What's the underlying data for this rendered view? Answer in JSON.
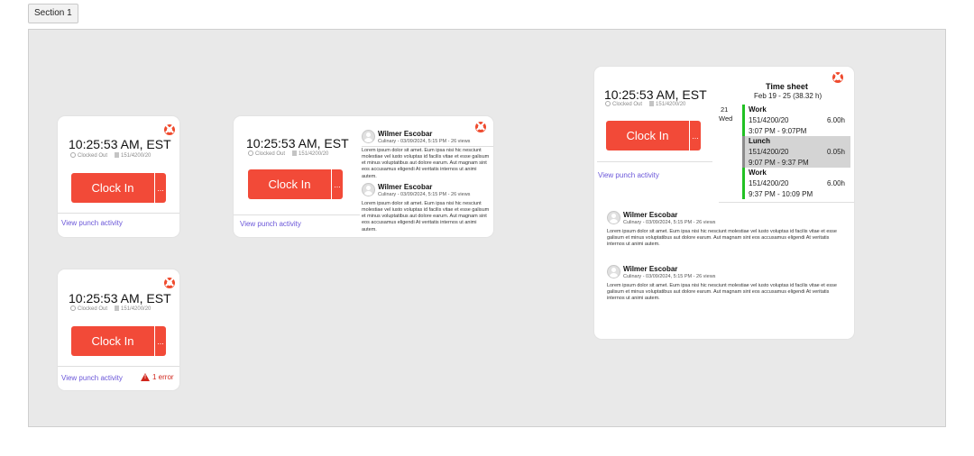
{
  "section": {
    "label": "Section 1"
  },
  "widget": {
    "time": "10:25:53 AM, EST",
    "status": "Clocked Out",
    "code": "151/4200/20",
    "clock_in": "Clock In",
    "more": "...",
    "view_punch": "View punch activity",
    "error": "1 error",
    "logo_icon": "brand-logo-icon"
  },
  "posts": [
    {
      "name": "Wilmer Escobar",
      "sub": "Culinary - 03/09/2024, 5:15 PM - 26 views",
      "body": "Lorem ipsum dolor sit amet. Eum ipsa nisi hic nesciunt molestiae vel iusto voluptas id facilis vitae et esse galisum et minus voluptatibus aut dolore earum. Aut magnam sint eos accusamus eligendi At veritatis internos ut animi autem."
    },
    {
      "name": "Wilmer Escobar",
      "sub": "Culinary - 03/09/2024, 5:15 PM - 26 views",
      "body": "Lorem ipsum dolor sit amet. Eum ipsa nisi hic nesciunt molestiae vel iusto voluptas id facilis vitae et esse galisum et minus voluptatibus aut dolore earum. Aut magnam sint eos accusamus eligendi At veritatis internos ut animi autem."
    }
  ],
  "timesheet": {
    "title": "Time sheet",
    "range": "Feb 19 - 25 (38.32 h)",
    "day_num": "21",
    "day_name": "Wed",
    "entries": [
      {
        "title": "Work",
        "code": "151/4200/20",
        "hours": "6.00h",
        "range": "3:07 PM - 9:07PM",
        "color": "#22c124",
        "bg": "#ffffff"
      },
      {
        "title": "Lunch",
        "code": "151/4200/20",
        "hours": "0.05h",
        "range": "9:07 PM - 9:37 PM",
        "color": "#8c8c8c",
        "bg": "#d4d4d4"
      },
      {
        "title": "Work",
        "code": "151/4200/20",
        "hours": "6.00h",
        "range": "9:37 PM - 10:09 PM",
        "color": "#22c124",
        "bg": "#ffffff"
      }
    ]
  }
}
